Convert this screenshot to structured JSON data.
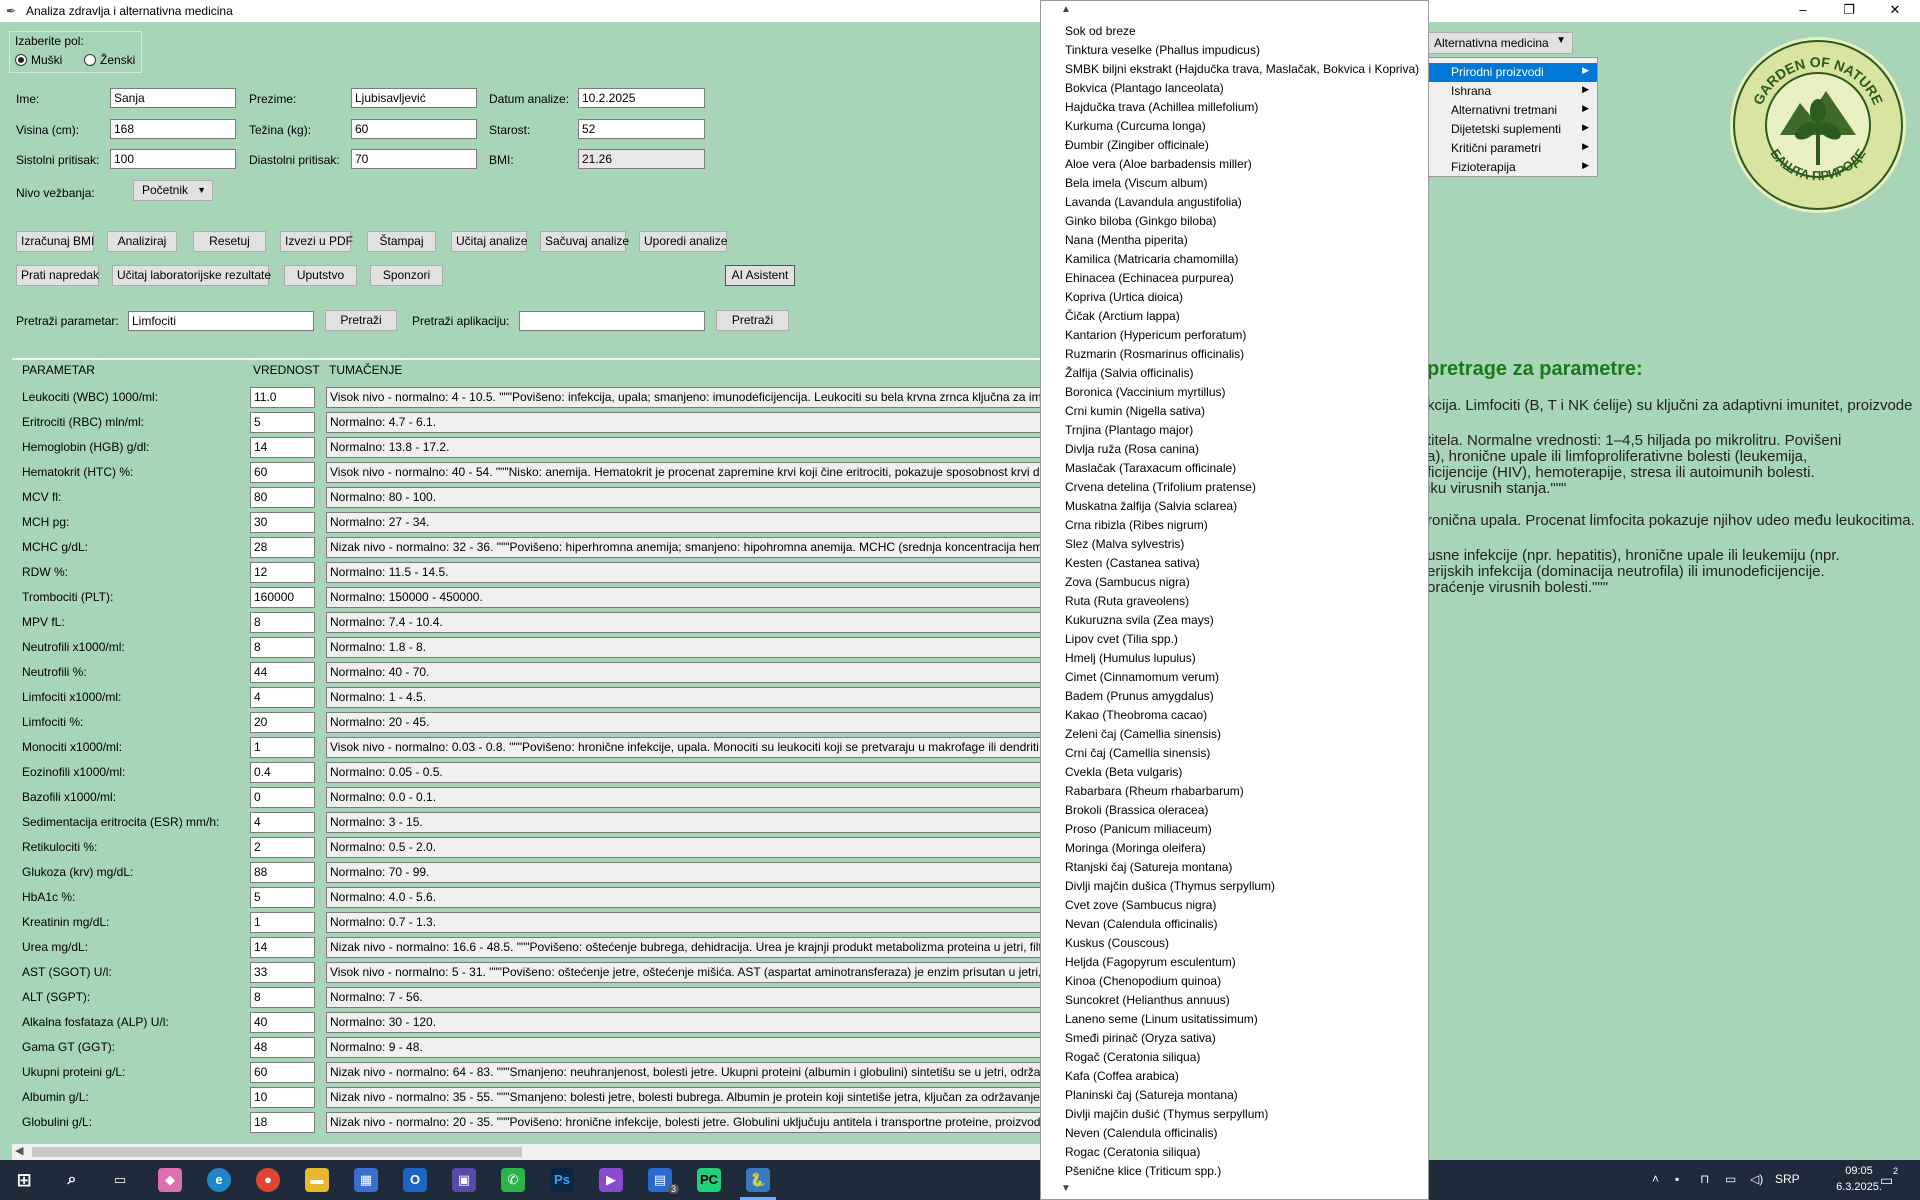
{
  "window": {
    "title": "Analiza zdravlja i alternativna medicina",
    "minimize": "–",
    "maximize": "❐",
    "close": "✕"
  },
  "gender": {
    "legend": "Izaberite pol:",
    "options": [
      "Muški",
      "Ženski"
    ],
    "selected": "Muški"
  },
  "form": {
    "ime_label": "Ime:",
    "ime": "Sanja",
    "prezime_label": "Prezime:",
    "prezime": "Ljubisavljević",
    "datum_label": "Datum analize:",
    "datum": "10.2.2025",
    "visina_label": "Visina (cm):",
    "visina": "168",
    "tezina_label": "Težina (kg):",
    "tezina": "60",
    "starost_label": "Starost:",
    "starost": "52",
    "sist_label": "Sistolni pritisak:",
    "sist": "100",
    "diast_label": "Diastolni pritisak:",
    "diast": "70",
    "bmi_label": "BMI:",
    "bmi": "21.26",
    "nivo_label": "Nivo vežbanja:",
    "nivo": "Početnik"
  },
  "buttons_row1": [
    "Izračunaj BMI",
    "Analiziraj",
    "Resetuj",
    "Izvezi u PDF",
    "Štampaj",
    "Učitaj analize",
    "Sačuvaj analize",
    "Uporedi analize"
  ],
  "buttons_row2": [
    "Prati napredak",
    "Učitaj laboratorijske rezultate",
    "Uputstvo",
    "Sponzori",
    "AI Asistent"
  ],
  "search": {
    "param_label": "Pretraži parametar:",
    "param_value": "Limfociti",
    "param_button": "Pretraži",
    "app_label": "Pretraži aplikaciju:",
    "app_value": "",
    "app_button": "Pretraži"
  },
  "table": {
    "headers": [
      "PARAMETAR",
      "VREDNOST",
      "TUMAČENJE"
    ],
    "rows": [
      {
        "name": "Leukociti (WBC) 1000/ml:",
        "value": "11.0",
        "tum": "Visok nivo - normalno: 4 - 10.5. \"\"\"Povišeno: infekcija, upala; smanjeno: imunodeficijencija. Leukociti su bela krvna zrnca ključna za im"
      },
      {
        "name": "Eritrociti (RBC) mln/ml:",
        "value": "5",
        "tum": "Normalno: 4.7 - 6.1."
      },
      {
        "name": "Hemoglobin (HGB) g/dl:",
        "value": "14",
        "tum": "Normalno: 13.8 - 17.2."
      },
      {
        "name": "Hematokrit (HTC) %:",
        "value": "60",
        "tum": "Visok nivo - normalno: 40 - 54. \"\"\"Nisko: anemija. Hematokrit je procenat zapremine krvi koji čine eritrociti, pokazuje sposobnost krvi da"
      },
      {
        "name": "MCV fl:",
        "value": "80",
        "tum": "Normalno: 80 - 100."
      },
      {
        "name": "MCH pg:",
        "value": "30",
        "tum": "Normalno: 27 - 34."
      },
      {
        "name": "MCHC g/dL:",
        "value": "28",
        "tum": "Nizak nivo - normalno: 32 - 36. \"\"\"Povišeno: hiperhromna anemija; smanjeno: hipohromna anemija. MCHC (srednja koncentracija hem"
      },
      {
        "name": "RDW %:",
        "value": "12",
        "tum": "Normalno: 11.5 - 14.5."
      },
      {
        "name": "Trombociti (PLT):",
        "value": "160000",
        "tum": "Normalno: 150000 - 450000."
      },
      {
        "name": "MPV fL:",
        "value": "8",
        "tum": "Normalno: 7.4 - 10.4."
      },
      {
        "name": "Neutrofili x1000/ml:",
        "value": "8",
        "tum": "Normalno: 1.8 - 8."
      },
      {
        "name": "Neutrofili %:",
        "value": "44",
        "tum": "Normalno: 40 - 70."
      },
      {
        "name": "Limfociti x1000/ml:",
        "value": "4",
        "tum": "Normalno: 1 - 4.5."
      },
      {
        "name": "Limfociti %:",
        "value": "20",
        "tum": "Normalno: 20 - 45."
      },
      {
        "name": "Monociti x1000/ml:",
        "value": "1",
        "tum": "Visok nivo - normalno: 0.03 - 0.8. \"\"\"Povišeno: hronične infekcije, upala. Monociti su leukociti koji se pretvaraju u makrofage ili dendriti"
      },
      {
        "name": "Eozinofili x1000/ml:",
        "value": "0.4",
        "tum": "Normalno: 0.05 - 0.5."
      },
      {
        "name": "Bazofili x1000/ml:",
        "value": "0",
        "tum": "Normalno: 0.0 - 0.1."
      },
      {
        "name": "Sedimentacija eritrocita (ESR) mm/h:",
        "value": "4",
        "tum": "Normalno: 3 - 15."
      },
      {
        "name": "Retikulociti %:",
        "value": "2",
        "tum": "Normalno: 0.5 - 2.0."
      },
      {
        "name": "Glukoza (krv) mg/dL:",
        "value": "88",
        "tum": "Normalno: 70 - 99."
      },
      {
        "name": "HbA1c %:",
        "value": "5",
        "tum": "Normalno: 4.0 - 5.6."
      },
      {
        "name": "Kreatinin mg/dL:",
        "value": "1",
        "tum": "Normalno: 0.7 - 1.3."
      },
      {
        "name": "Urea mg/dL:",
        "value": "14",
        "tum": "Nizak nivo - normalno: 16.6 - 48.5. \"\"\"Povišeno: oštećenje bubrega, dehidracija. Urea je krajnji produkt metabolizma proteina u jetri, filtr"
      },
      {
        "name": "AST (SGOT) U/l:",
        "value": "33",
        "tum": "Visok nivo - normalno: 5 - 31. \"\"\"Povišeno: oštećenje jetre, oštećenje mišića. AST (aspartat aminotransferaza) je enzim prisutan u jetri, sr"
      },
      {
        "name": "ALT (SGPT):",
        "value": "8",
        "tum": "Normalno: 7 - 56."
      },
      {
        "name": "Alkalna fosfataza (ALP) U/l:",
        "value": "40",
        "tum": "Normalno: 30 - 120."
      },
      {
        "name": "Gama GT (GGT):",
        "value": "48",
        "tum": "Normalno: 9 - 48."
      },
      {
        "name": "Ukupni proteini g/L:",
        "value": "60",
        "tum": "Nizak nivo - normalno: 64 - 83. \"\"\"Smanjeno: neuhranjenost, bolesti jetre. Ukupni proteini (albumin i globulini) sintetišu se u jetri, održa"
      },
      {
        "name": "Albumin g/L:",
        "value": "10",
        "tum": "Nizak nivo - normalno: 35 - 55. \"\"\"Smanjeno: bolesti jetre, bolesti bubrega. Albumin je protein koji sintetiše jetra, ključan za održavanje o"
      },
      {
        "name": "Globulini g/L:",
        "value": "18",
        "tum": "Nizak nivo - normalno: 20 - 35. \"\"\"Povišeno: hronične infekcije, bolesti jetre. Globulini uključuju antitela i transportne proteine, proizvod"
      }
    ]
  },
  "info_panel": {
    "heading": "pretrage za parametre:",
    "lines": [
      "kcija. Limfociti (B, T i NK ćelije) su ključni za adaptivni imunitet, proizvode",
      "",
      "titela. Normalne vrednosti: 1–4,5 hiljada po mikrolitru. Povišeni",
      "a), hronične upale ili limfoproliferativne bolesti (leukemija,",
      "ficijencije (HIV), hemoterapije, stresa ili autoimunih bolesti.",
      "iku virusnih stanja.\"\"\"",
      "",
      "ronična upala. Procenat limfocita pokazuje njihov udeo među leukocitima.",
      "",
      "usne infekcije (npr. hepatitis), hronične upale ili leukemiju (npr.",
      "erijskih infekcija (dominacija neutrofila) ili imunodeficijencije.",
      "oraćenje virusnih bolesti.\"\"\""
    ]
  },
  "menu": {
    "button": "Alternativna medicina",
    "items": [
      "Prirodni proizvodi",
      "Ishrana",
      "Alternativni tretmani",
      "Dijetetski suplementi",
      "Kritični parametri",
      "Fizioterapija"
    ],
    "selected": "Prirodni proizvodi"
  },
  "logo": {
    "top_text": "GARDEN OF NATURE",
    "bottom_text": "БАШТА ПРИРОДЕ"
  },
  "product_list": [
    "Sok od breze",
    "Tinktura veselke (Phallus impudicus)",
    "SMBK biljni ekstrakt (Hajdučka trava, Maslačak, Bokvica i Kopriva)",
    "Bokvica (Plantago lanceolata)",
    "Hajdučka trava (Achillea millefolium)",
    "Kurkuma (Curcuma longa)",
    "Đumbir (Zingiber officinale)",
    "Aloe vera (Aloe barbadensis miller)",
    "Bela imela (Viscum album)",
    "Lavanda (Lavandula angustifolia)",
    "Ginko biloba (Ginkgo biloba)",
    "Nana (Mentha piperita)",
    "Kamilica (Matricaria chamomilla)",
    "Ehinacea (Echinacea purpurea)",
    "Kopriva (Urtica dioica)",
    "Čičak (Arctium lappa)",
    "Kantarion (Hypericum perforatum)",
    "Ruzmarin (Rosmarinus officinalis)",
    "Žalfija (Salvia officinalis)",
    "Boronica (Vaccinium myrtillus)",
    "Crni kumin (Nigella sativa)",
    "Trnjina (Plantago major)",
    "Divlja ruža (Rosa canina)",
    "Maslačak (Taraxacum officinale)",
    "Crvena detelina (Trifolium pratense)",
    "Muskatna žalfija (Salvia sclarea)",
    "Crna ribizla (Ribes nigrum)",
    "Slez (Malva sylvestris)",
    "Kesten (Castanea sativa)",
    "Zova (Sambucus nigra)",
    "Ruta (Ruta graveolens)",
    "Kukuruzna svila (Zea mays)",
    "Lipov cvet (Tilia spp.)",
    "Hmelj (Humulus lupulus)",
    "Cimet (Cinnamomum verum)",
    "Badem (Prunus amygdalus)",
    "Kakao (Theobroma cacao)",
    "Zeleni čaj (Camellia sinensis)",
    "Crni čaj (Camellia sinensis)",
    "Cvekla (Beta vulgaris)",
    "Rabarbara (Rheum rhabarbarum)",
    "Brokoli (Brassica oleracea)",
    "Proso (Panicum miliaceum)",
    "Moringa (Moringa oleifera)",
    "Rtanjski čaj (Satureja montana)",
    "Divlji majčin dušica (Thymus serpyllum)",
    "Cvet zove (Sambucus nigra)",
    "Nevan (Calendula officinalis)",
    "Kuskus (Couscous)",
    "Heljda (Fagopyrum esculentum)",
    "Kinoa (Chenopodium quinoa)",
    "Suncokret (Helianthus annuus)",
    "Laneno seme (Linum usitatissimum)",
    "Smeđi pirinač (Oryza sativa)",
    "Rogač (Ceratonia siliqua)",
    "Kafa (Coffea arabica)",
    "Planinski čaj (Satureja montana)",
    "Divlji majčin dušić (Thymus serpyllum)",
    "Neven (Calendula officinalis)",
    "Rogac (Ceratonia siliqua)",
    "Pšenične klice (Triticum spp.)"
  ],
  "taskbar": {
    "lang": "SRP",
    "time": "09:05",
    "date": "6.3.2025.",
    "badge": "3",
    "notif": "2"
  },
  "colors": {
    "background": "#a8d5b8",
    "heading_green": "#1a7a1a",
    "menu_selected": "#0078d7",
    "taskbar": "#1f2a3a"
  }
}
